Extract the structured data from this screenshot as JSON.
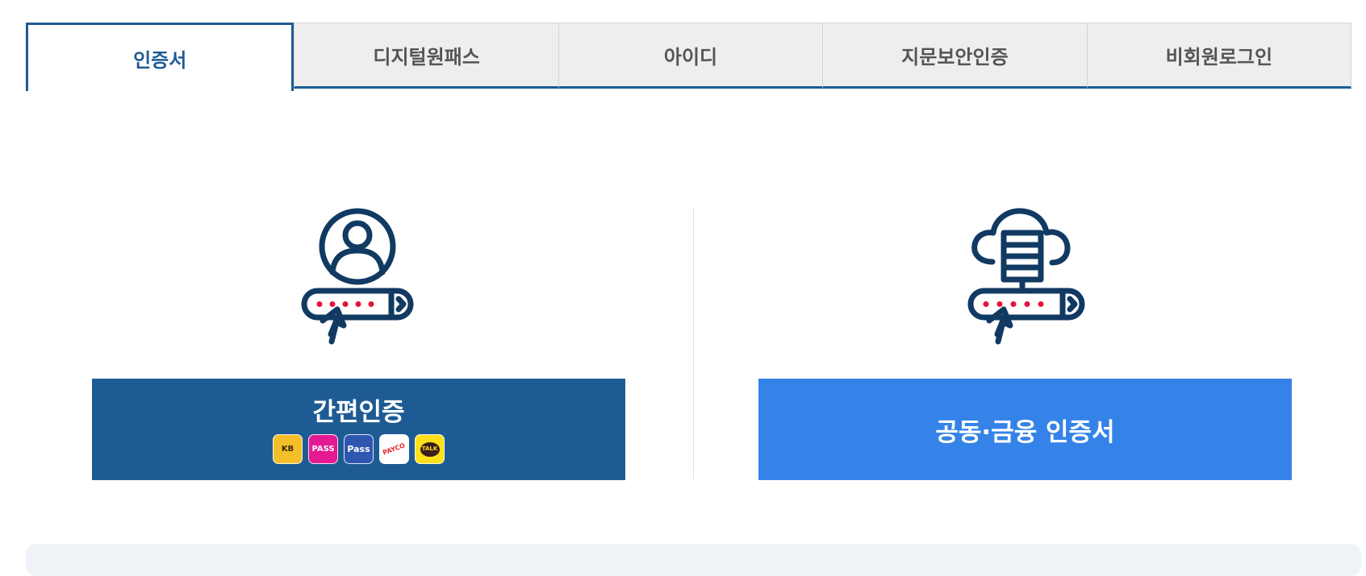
{
  "tabs": [
    {
      "label": "인증서",
      "active": true
    },
    {
      "label": "디지털원패스",
      "active": false
    },
    {
      "label": "아이디",
      "active": false
    },
    {
      "label": "지문보안인증",
      "active": false
    },
    {
      "label": "비회원로그인",
      "active": false
    }
  ],
  "options": {
    "simple": {
      "label": "간편인증",
      "badges": [
        "KB",
        "PASS",
        "Pass",
        "PAYCO",
        "TALK"
      ]
    },
    "certificate": {
      "label": "공동·금융 인증서"
    }
  },
  "colors": {
    "primary": "#1e5b94",
    "accent_blue": "#3583e8",
    "icon_stroke": "#113a62",
    "icon_dots": "#e5133a"
  },
  "icons": {
    "simple": "user-password-icon",
    "certificate": "cloud-server-password-icon"
  }
}
